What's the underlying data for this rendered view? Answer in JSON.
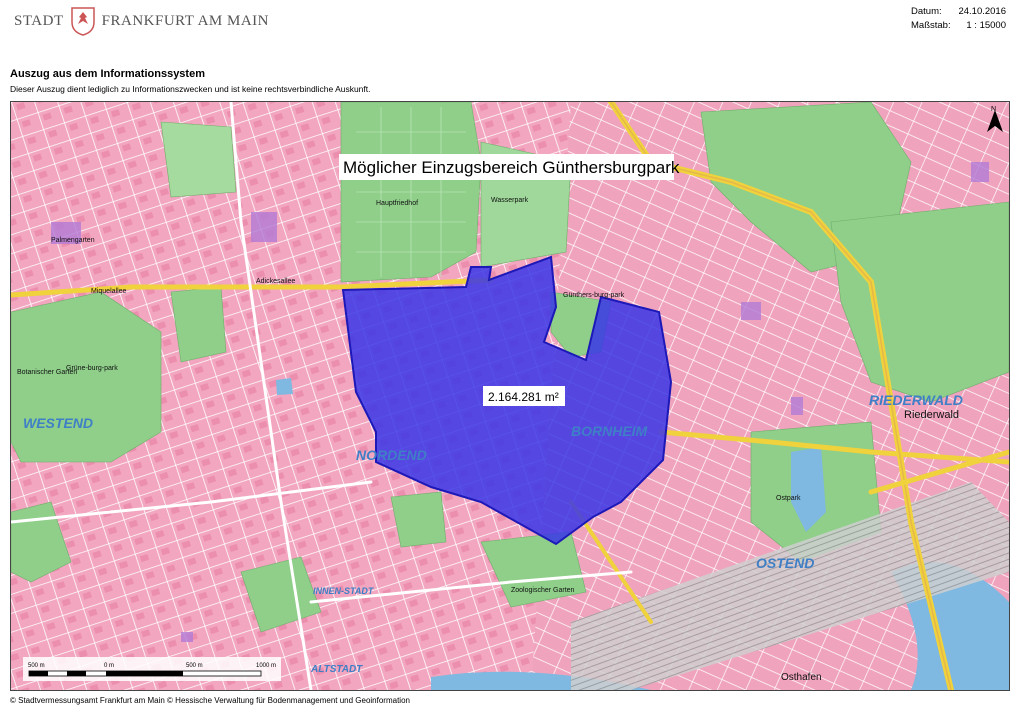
{
  "header": {
    "logo_text_a": "Stadt",
    "logo_text_b": "Frankfurt am Main",
    "datum_label": "Datum:",
    "datum_value": "24.10.2016",
    "massstab_label": "Maßstab:",
    "massstab_value": "1 : 15000"
  },
  "section": {
    "title": "Auszug aus dem Informationssystem",
    "subtitle": "Dieser Auszug dient lediglich zu Informationszwecken und ist keine rechtsverbindliche Auskunft."
  },
  "map": {
    "title_label": "Möglicher Einzugsbereich Günthersburgpark",
    "area_label": "2.164.281 m²",
    "colors": {
      "polygon_fill": "#3a36e6",
      "polygon_stroke": "#1d18b8",
      "urban": "#f2a6bf",
      "green": "#8fcf8a",
      "water": "#7fb8e0",
      "highway": "#f0d23c",
      "label_blue": "#3f7fc6"
    },
    "district_labels": [
      "WESTEND",
      "NORDEND",
      "BORNHEIM",
      "RIEDERWALD",
      "OSTEND",
      "INNEN-STADT",
      "ALTSTADT"
    ],
    "place_labels": [
      "Riederwald",
      "Osthafen",
      "Hauptfriedhof",
      "Wasserpark",
      "Ostpark",
      "Zoologischer Garten",
      "Miquelallee",
      "Adickesallee",
      "Palmengarten",
      "Botanischer Garten",
      "Grüne-burg-park",
      "Günthers-burg-park"
    ],
    "north_label": "N",
    "scale": {
      "labels": [
        "500 m",
        "0 m",
        "500 m",
        "1000 m"
      ]
    }
  },
  "footer": {
    "text": "© Stadtvermessungsamt Frankfurt am Main © Hessische Verwaltung für Bodenmanagement und Geoinformation"
  }
}
